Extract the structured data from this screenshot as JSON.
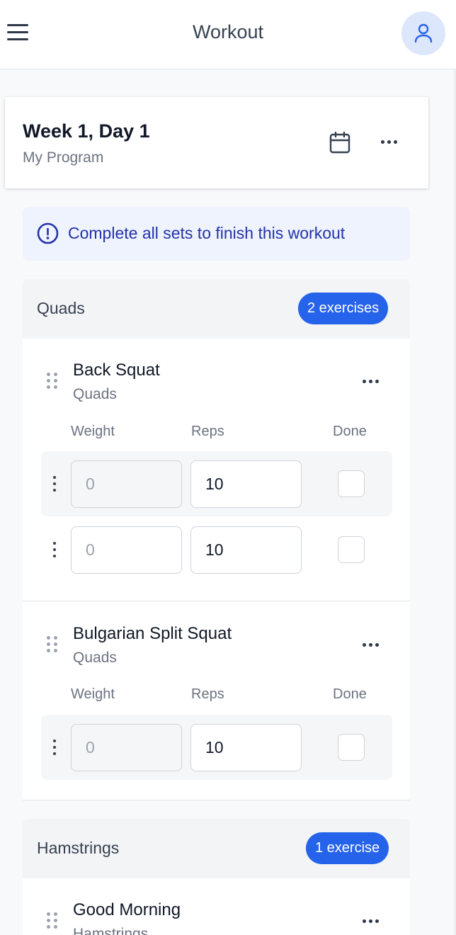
{
  "header": {
    "title": "Workout",
    "menu_icon": "hamburger-menu-icon",
    "profile_icon": "user-icon"
  },
  "day": {
    "title": "Week 1, Day 1",
    "program": "My Program"
  },
  "banner": {
    "text": "Complete all sets to finish this workout"
  },
  "columns": {
    "weight": "Weight",
    "reps": "Reps",
    "done": "Done"
  },
  "groups": [
    {
      "name": "Quads",
      "badge": "2 exercises",
      "exercises": [
        {
          "name": "Back Squat",
          "muscle": "Quads",
          "sets": [
            {
              "weight_placeholder": "0",
              "reps": "10",
              "done": false
            },
            {
              "weight_placeholder": "0",
              "reps": "10",
              "done": false
            }
          ]
        },
        {
          "name": "Bulgarian Split Squat",
          "muscle": "Quads",
          "sets": [
            {
              "weight_placeholder": "0",
              "reps": "10",
              "done": false
            }
          ]
        }
      ]
    },
    {
      "name": "Hamstrings",
      "badge": "1 exercise",
      "exercises": [
        {
          "name": "Good Morning",
          "muscle": "Hamstrings",
          "sets": []
        }
      ]
    }
  ],
  "colors": {
    "accent": "#2563eb",
    "banner_bg": "#eef3fd",
    "banner_text": "#2432a8"
  }
}
